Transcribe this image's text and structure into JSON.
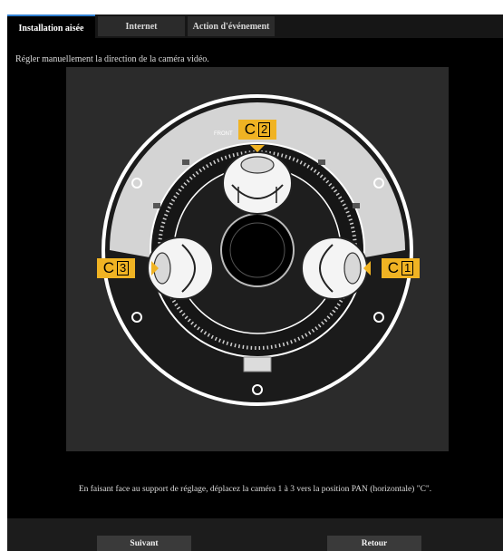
{
  "tabs": [
    {
      "label": "Installation aisée",
      "active": true
    },
    {
      "label": "Internet",
      "active": false
    },
    {
      "label": "Action d'événement",
      "active": false
    }
  ],
  "intro_text": "Régler manuellement la direction de la caméra vidéo.",
  "diagram": {
    "front_label": "FRONT",
    "cameras": [
      {
        "prefix": "C",
        "number": "1"
      },
      {
        "prefix": "C",
        "number": "2"
      },
      {
        "prefix": "C",
        "number": "3"
      }
    ],
    "accent_color": "#f0b323"
  },
  "instruction_text": "En faisant face au support de réglage, déplacez la caméra 1 à 3 vers la position PAN (horizontale) \"C\".",
  "buttons": {
    "next": "Suivant",
    "back": "Retour"
  }
}
